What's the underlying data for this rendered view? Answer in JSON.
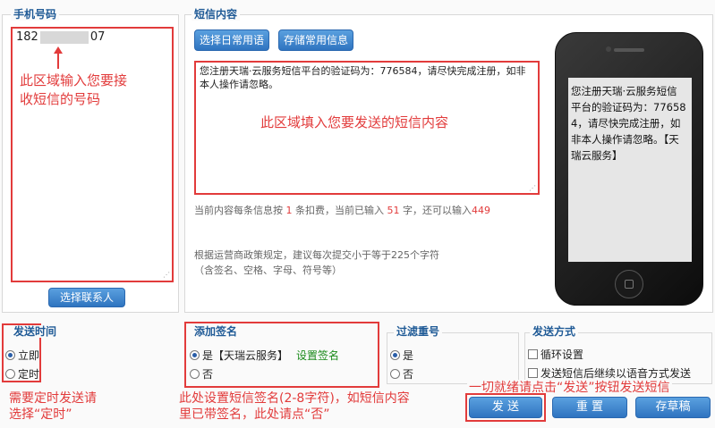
{
  "phone_section": {
    "legend": "手机号码",
    "number_start": "182",
    "number_end": "07",
    "annotation": "此区域输入您要接收短信的号码",
    "select_contact_button": "选择联系人"
  },
  "sms_section": {
    "legend": "短信内容",
    "common_phrase_button": "选择日常用语",
    "save_common_button": "存储常用信息",
    "message_text": "您注册天瑞·云服务短信平台的验证码为：776584，请尽快完成注册，如非本人操作请忽略。",
    "annotation": "此区域填入您要发送的短信内容",
    "count_prefix": "当前内容每条信息按",
    "count_billing": "1",
    "count_mid1": "条扣费，当前已输入",
    "count_typed": "51",
    "count_mid2": "字，还可以输入",
    "count_remaining": "449",
    "policy_line1": "根据运营商政策规定，建议每次提交小于等于225个字符",
    "policy_line2": "（含签名、空格、字母、符号等）",
    "preview_text": "您注册天瑞·云服务短信平台的验证码为：776584，请尽快完成注册，如非本人操作请忽略。【天瑞云服务】"
  },
  "send_time": {
    "legend": "发送时间",
    "option_now": "立即",
    "option_scheduled": "定时",
    "annotation": "需要定时发送请选择“定时”"
  },
  "signature": {
    "legend": "添加签名",
    "option_yes": "是【天瑞云服务】",
    "set_link": "设置签名",
    "option_no": "否",
    "annotation": "此处设置短信签名(2-8字符)，如短信内容里已带签名，此处请点“否”"
  },
  "dedupe": {
    "legend": "过滤重号",
    "option_yes": "是",
    "option_no": "否"
  },
  "send_method": {
    "legend": "发送方式",
    "loop_setting": "循环设置",
    "voice_followup": "发送短信后继续以语音方式发送",
    "annotation": "一切就绪请点击“发送”按钮发送短信"
  },
  "actions": {
    "send": "发 送",
    "reset": "重 置",
    "draft": "存草稿"
  },
  "colors": {
    "accent": "#2f74c0",
    "annotation": "#e23b3b",
    "link": "#1a8a1a"
  }
}
